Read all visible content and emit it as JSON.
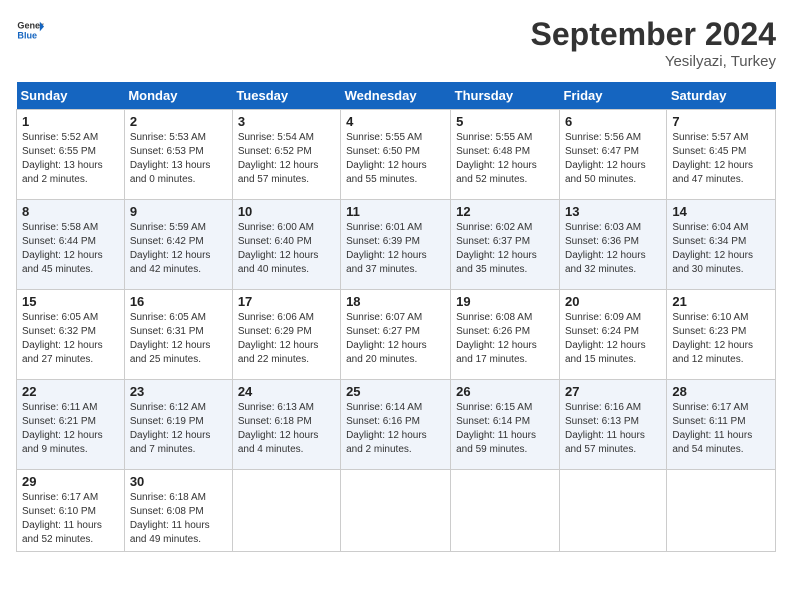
{
  "header": {
    "logo_line1": "General",
    "logo_line2": "Blue",
    "month_year": "September 2024",
    "location": "Yesilyazi, Turkey"
  },
  "weekdays": [
    "Sunday",
    "Monday",
    "Tuesday",
    "Wednesday",
    "Thursday",
    "Friday",
    "Saturday"
  ],
  "weeks": [
    [
      {
        "day": "1",
        "info": "Sunrise: 5:52 AM\nSunset: 6:55 PM\nDaylight: 13 hours\nand 2 minutes."
      },
      {
        "day": "2",
        "info": "Sunrise: 5:53 AM\nSunset: 6:53 PM\nDaylight: 13 hours\nand 0 minutes."
      },
      {
        "day": "3",
        "info": "Sunrise: 5:54 AM\nSunset: 6:52 PM\nDaylight: 12 hours\nand 57 minutes."
      },
      {
        "day": "4",
        "info": "Sunrise: 5:55 AM\nSunset: 6:50 PM\nDaylight: 12 hours\nand 55 minutes."
      },
      {
        "day": "5",
        "info": "Sunrise: 5:55 AM\nSunset: 6:48 PM\nDaylight: 12 hours\nand 52 minutes."
      },
      {
        "day": "6",
        "info": "Sunrise: 5:56 AM\nSunset: 6:47 PM\nDaylight: 12 hours\nand 50 minutes."
      },
      {
        "day": "7",
        "info": "Sunrise: 5:57 AM\nSunset: 6:45 PM\nDaylight: 12 hours\nand 47 minutes."
      }
    ],
    [
      {
        "day": "8",
        "info": "Sunrise: 5:58 AM\nSunset: 6:44 PM\nDaylight: 12 hours\nand 45 minutes."
      },
      {
        "day": "9",
        "info": "Sunrise: 5:59 AM\nSunset: 6:42 PM\nDaylight: 12 hours\nand 42 minutes."
      },
      {
        "day": "10",
        "info": "Sunrise: 6:00 AM\nSunset: 6:40 PM\nDaylight: 12 hours\nand 40 minutes."
      },
      {
        "day": "11",
        "info": "Sunrise: 6:01 AM\nSunset: 6:39 PM\nDaylight: 12 hours\nand 37 minutes."
      },
      {
        "day": "12",
        "info": "Sunrise: 6:02 AM\nSunset: 6:37 PM\nDaylight: 12 hours\nand 35 minutes."
      },
      {
        "day": "13",
        "info": "Sunrise: 6:03 AM\nSunset: 6:36 PM\nDaylight: 12 hours\nand 32 minutes."
      },
      {
        "day": "14",
        "info": "Sunrise: 6:04 AM\nSunset: 6:34 PM\nDaylight: 12 hours\nand 30 minutes."
      }
    ],
    [
      {
        "day": "15",
        "info": "Sunrise: 6:05 AM\nSunset: 6:32 PM\nDaylight: 12 hours\nand 27 minutes."
      },
      {
        "day": "16",
        "info": "Sunrise: 6:05 AM\nSunset: 6:31 PM\nDaylight: 12 hours\nand 25 minutes."
      },
      {
        "day": "17",
        "info": "Sunrise: 6:06 AM\nSunset: 6:29 PM\nDaylight: 12 hours\nand 22 minutes."
      },
      {
        "day": "18",
        "info": "Sunrise: 6:07 AM\nSunset: 6:27 PM\nDaylight: 12 hours\nand 20 minutes."
      },
      {
        "day": "19",
        "info": "Sunrise: 6:08 AM\nSunset: 6:26 PM\nDaylight: 12 hours\nand 17 minutes."
      },
      {
        "day": "20",
        "info": "Sunrise: 6:09 AM\nSunset: 6:24 PM\nDaylight: 12 hours\nand 15 minutes."
      },
      {
        "day": "21",
        "info": "Sunrise: 6:10 AM\nSunset: 6:23 PM\nDaylight: 12 hours\nand 12 minutes."
      }
    ],
    [
      {
        "day": "22",
        "info": "Sunrise: 6:11 AM\nSunset: 6:21 PM\nDaylight: 12 hours\nand 9 minutes."
      },
      {
        "day": "23",
        "info": "Sunrise: 6:12 AM\nSunset: 6:19 PM\nDaylight: 12 hours\nand 7 minutes."
      },
      {
        "day": "24",
        "info": "Sunrise: 6:13 AM\nSunset: 6:18 PM\nDaylight: 12 hours\nand 4 minutes."
      },
      {
        "day": "25",
        "info": "Sunrise: 6:14 AM\nSunset: 6:16 PM\nDaylight: 12 hours\nand 2 minutes."
      },
      {
        "day": "26",
        "info": "Sunrise: 6:15 AM\nSunset: 6:14 PM\nDaylight: 11 hours\nand 59 minutes."
      },
      {
        "day": "27",
        "info": "Sunrise: 6:16 AM\nSunset: 6:13 PM\nDaylight: 11 hours\nand 57 minutes."
      },
      {
        "day": "28",
        "info": "Sunrise: 6:17 AM\nSunset: 6:11 PM\nDaylight: 11 hours\nand 54 minutes."
      }
    ],
    [
      {
        "day": "29",
        "info": "Sunrise: 6:17 AM\nSunset: 6:10 PM\nDaylight: 11 hours\nand 52 minutes."
      },
      {
        "day": "30",
        "info": "Sunrise: 6:18 AM\nSunset: 6:08 PM\nDaylight: 11 hours\nand 49 minutes."
      },
      {
        "day": "",
        "info": ""
      },
      {
        "day": "",
        "info": ""
      },
      {
        "day": "",
        "info": ""
      },
      {
        "day": "",
        "info": ""
      },
      {
        "day": "",
        "info": ""
      }
    ]
  ]
}
